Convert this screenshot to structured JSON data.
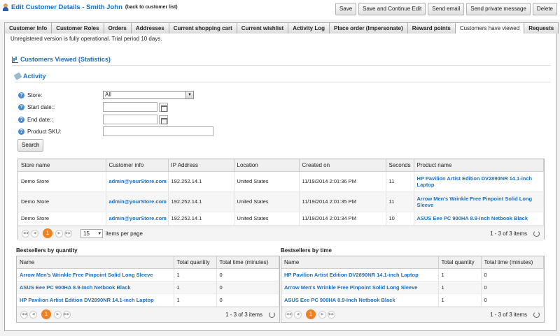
{
  "header": {
    "title": "Edit Customer Details - Smith John",
    "back_link": "(back to customer list)",
    "buttons": [
      "Save",
      "Save and Continue Edit",
      "Send email",
      "Send private message",
      "Delete"
    ]
  },
  "tabs": [
    "Customer Info",
    "Customer Roles",
    "Orders",
    "Addresses",
    "Current shopping cart",
    "Current wishlist",
    "Activity Log",
    "Place order (Impersonate)",
    "Reward points",
    "Customers have viewed",
    "Requests"
  ],
  "active_tab": "Customers have viewed",
  "notice": "Unregistered version is fully operational. Trial period 10 days.",
  "section_title": "Customers Viewed (Statistics)",
  "activity_title": "Activity",
  "form": {
    "store_label": "Store:",
    "store_value": "All",
    "start_label": "Start date::",
    "end_label": "End date::",
    "sku_label": "Product SKU:",
    "search_label": "Search"
  },
  "main_grid": {
    "columns": [
      "Store name",
      "Customer info",
      "IP Address",
      "Location",
      "Created on",
      "Seconds",
      "Product name"
    ],
    "rows": [
      [
        "Demo Store",
        "admin@yourStore.com",
        "192.252.14.1",
        "United States",
        "11/19/2014 2:01:36 PM",
        "11",
        "HP Pavilion Artist Edition DV2890NR 14.1-inch Laptop"
      ],
      [
        "Demo Store",
        "admin@yourStore.com",
        "192.252.14.1",
        "United States",
        "11/19/2014 2:01:35 PM",
        "11",
        "Arrow Men's Wrinkle Free Pinpoint Solid Long Sleeve"
      ],
      [
        "Demo Store",
        "admin@yourStore.com",
        "192.252.14.1",
        "United States",
        "11/19/2014 2:01:34 PM",
        "10",
        "ASUS Eee PC 900HA 8.9-Inch Netbook Black"
      ]
    ],
    "pager": {
      "current": "1",
      "page_size": "15",
      "page_size_label": "items per page",
      "info": "1 - 3 of 3 items"
    }
  },
  "bestsellers_qty": {
    "title": "Bestsellers by quantity",
    "columns": [
      "Name",
      "Total quantity",
      "Total time (minutes)"
    ],
    "rows": [
      [
        "Arrow Men's Wrinkle Free Pinpoint Solid Long Sleeve",
        "1",
        "0"
      ],
      [
        "ASUS Eee PC 900HA 8.9-Inch Netbook Black",
        "1",
        "0"
      ],
      [
        "HP Pavilion Artist Edition DV2890NR 14.1-inch Laptop",
        "1",
        "0"
      ]
    ],
    "pager": {
      "current": "1",
      "info": "1 - 3 of 3 items"
    }
  },
  "bestsellers_time": {
    "title": "Bestsellers by time",
    "columns": [
      "Name",
      "Total quantity",
      "Total time (minutes)"
    ],
    "rows": [
      [
        "HP Pavilion Artist Edition DV2890NR 14.1-inch Laptop",
        "1",
        "0"
      ],
      [
        "Arrow Men's Wrinkle Free Pinpoint Solid Long Sleeve",
        "1",
        "0"
      ],
      [
        "ASUS Eee PC 900HA 8.9-Inch Netbook Black",
        "1",
        "0"
      ]
    ],
    "pager": {
      "current": "1",
      "info": "1 - 3 of 3 items"
    }
  },
  "annotation": {
    "color": "#e02020"
  },
  "colors": {
    "link": "#1b6fc2",
    "pager_current": "#f08020"
  }
}
